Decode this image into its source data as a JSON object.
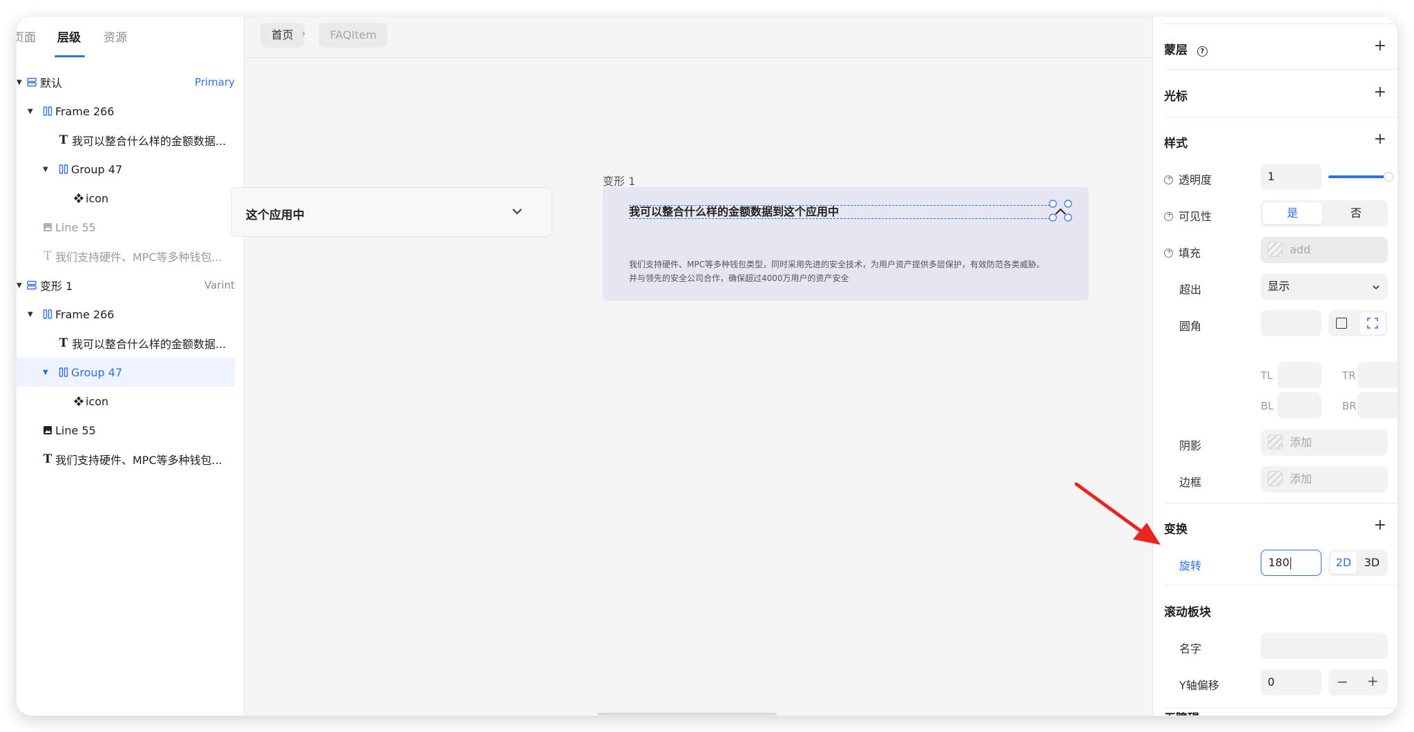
{
  "left_tabs": [
    "页面",
    "层级",
    "资源"
  ],
  "tree": [
    {
      "label": "默认",
      "tag": "Primary"
    },
    {
      "label": "Frame 266"
    },
    {
      "label": "我可以整合什么样的金额数据..."
    },
    {
      "label": "Group 47"
    },
    {
      "label": "icon"
    },
    {
      "label": "Line 55"
    },
    {
      "label": "我们支持硬件、MPC等多种钱包..."
    },
    {
      "label": "变形 1",
      "tag": "Varint"
    },
    {
      "label": "Frame 266"
    },
    {
      "label": "我可以整合什么样的金额数据..."
    },
    {
      "label": "Group 47"
    },
    {
      "label": "icon"
    },
    {
      "label": "Line 55"
    },
    {
      "label": "我们支持硬件、MPC等多种钱包..."
    }
  ],
  "breadcrumb": {
    "home": "首页",
    "current": "FAQItem"
  },
  "canvas": {
    "left_card_title": "这个应用中",
    "variant_label": "变形 1",
    "question": "我可以整合什么样的金额数据到这个应用中",
    "answer_line1": "我们支持硬件、MPC等多种钱包类型，同时采用先进的安全技术，为用户资产提供多层保护，有效防范各类威胁。",
    "answer_line2": "并与领先的安全公司合作，确保超过4000万用户的资产安全"
  },
  "props": {
    "mask": "蒙层",
    "cursor": "光标",
    "style": "样式",
    "opacity_label": "透明度",
    "opacity_value": "1",
    "visibility_label": "可见性",
    "vis_yes": "是",
    "vis_no": "否",
    "fill_label": "填充",
    "fill_placeholder": "add",
    "overflow_label": "超出",
    "overflow_value": "显示",
    "radius_label": "圆角",
    "tl": "TL",
    "tr": "TR",
    "bl": "BL",
    "br": "BR",
    "shadow_label": "阴影",
    "shadow_placeholder": "添加",
    "border_label": "边框",
    "border_placeholder": "添加",
    "transform": "变换",
    "rotate_label": "旋转",
    "rotate_value": "180",
    "mode_2d": "2D",
    "mode_3d": "3D",
    "scroll_section": "滚动板块",
    "name_label": "名字",
    "yoffset_label": "Y轴偏移",
    "yoffset_value": "0",
    "minus": "−",
    "plus": "+",
    "accessibility": "无障碍"
  },
  "colors": {
    "accent": "#2f6fed",
    "arrow": "#e8261f",
    "variant_bg": "#e6e6f3"
  }
}
